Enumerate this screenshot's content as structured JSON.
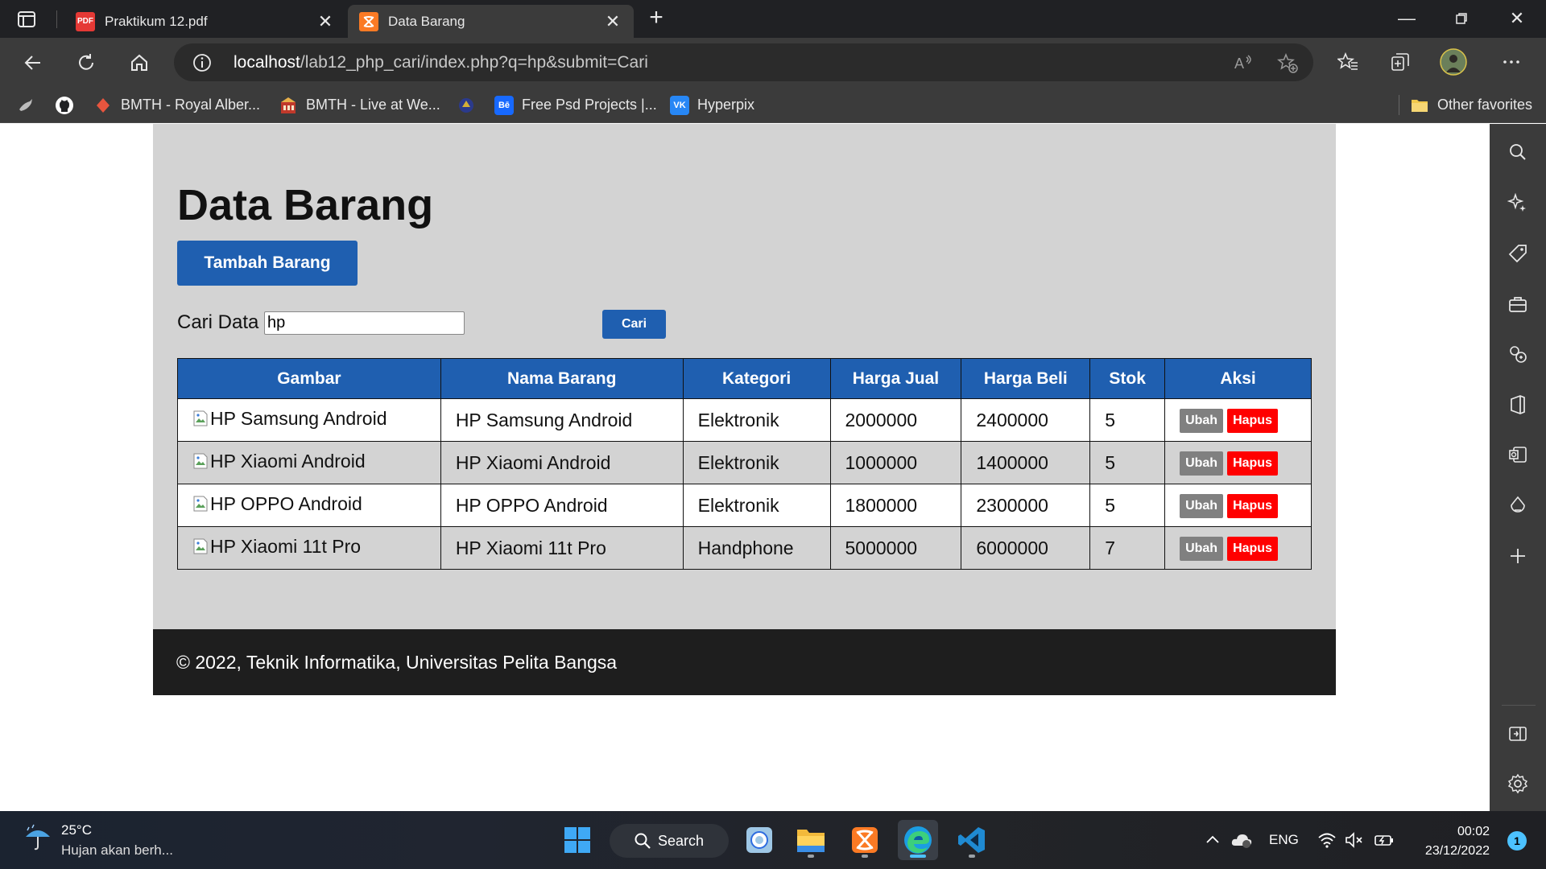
{
  "browser": {
    "tabs": [
      {
        "title": "Praktikum 12.pdf",
        "favicon": "pdf-icon",
        "active": false
      },
      {
        "title": "Data Barang",
        "favicon": "xampp-icon",
        "active": true
      }
    ],
    "url_host": "localhost",
    "url_path": "/lab12_php_cari/index.php?q=hp&submit=Cari",
    "bookmarks": [
      {
        "label": "",
        "icon": "bird-icon"
      },
      {
        "label": "",
        "icon": "github-icon"
      },
      {
        "label": "BMTH - Royal Alber...",
        "icon": "diamond-icon"
      },
      {
        "label": "BMTH - Live at We...",
        "icon": "building-icon"
      },
      {
        "label": "",
        "icon": "emblem-icon"
      },
      {
        "label": "Free Psd Projects |...",
        "icon": "behance-icon"
      },
      {
        "label": "Hyperpix",
        "icon": "vk-icon"
      }
    ],
    "other_favorites": "Other favorites"
  },
  "page": {
    "title": "Data Barang",
    "add_button": "Tambah Barang",
    "search_label": "Cari Data",
    "search_value": "hp",
    "search_button": "Cari",
    "table": {
      "headers": [
        "Gambar",
        "Nama Barang",
        "Kategori",
        "Harga Jual",
        "Harga Beli",
        "Stok",
        "Aksi"
      ],
      "rows": [
        {
          "gambar_alt": "HP Samsung Android",
          "nama": "HP Samsung Android",
          "kategori": "Elektronik",
          "harga_jual": "2000000",
          "harga_beli": "2400000",
          "stok": "5"
        },
        {
          "gambar_alt": "HP Xiaomi Android",
          "nama": "HP Xiaomi Android",
          "kategori": "Elektronik",
          "harga_jual": "1000000",
          "harga_beli": "1400000",
          "stok": "5"
        },
        {
          "gambar_alt": "HP OPPO Android",
          "nama": "HP OPPO Android",
          "kategori": "Elektronik",
          "harga_jual": "1800000",
          "harga_beli": "2300000",
          "stok": "5"
        },
        {
          "gambar_alt": "HP Xiaomi 11t Pro",
          "nama": "HP Xiaomi 11t Pro",
          "kategori": "Handphone",
          "harga_jual": "5000000",
          "harga_beli": "6000000",
          "stok": "7"
        }
      ],
      "action_edit": "Ubah",
      "action_delete": "Hapus"
    },
    "footer": "© 2022, Teknik Informatika, Universitas Pelita Bangsa"
  },
  "taskbar": {
    "weather_temp": "25°C",
    "weather_desc": "Hujan akan berh...",
    "search_label": "Search",
    "lang": "ENG",
    "time": "00:02",
    "date": "23/12/2022",
    "notification_count": "1"
  },
  "colors": {
    "primary": "#1f5fb0",
    "danger": "#ff0000",
    "muted": "#808080",
    "page_bg": "#d3d3d3",
    "footer_bg": "#1e1e1e"
  }
}
